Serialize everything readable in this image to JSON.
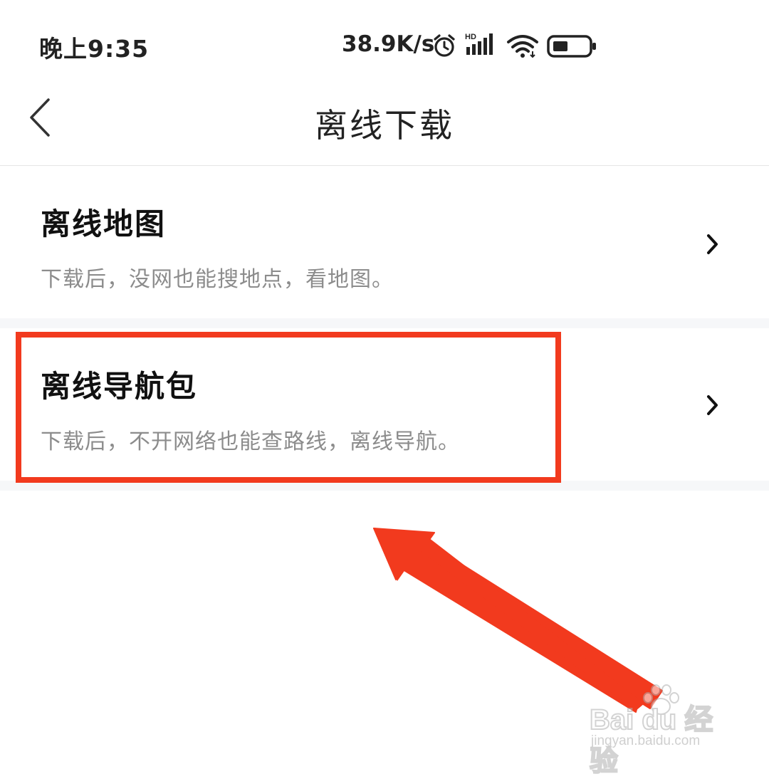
{
  "status_bar": {
    "time": "晚上9:35",
    "network_speed": "38.9K/s",
    "icons": [
      "alarm-icon",
      "hd-signal-icon",
      "wifi-icon",
      "battery-icon"
    ],
    "network_label": "HD"
  },
  "nav": {
    "title": "离线下载",
    "back_icon": "chevron-left-icon"
  },
  "items": [
    {
      "title": "离线地图",
      "description": "下载后，没网也能搜地点，看地图。"
    },
    {
      "title": "离线导航包",
      "description": "下载后，不开网络也能查路线，离线导航。"
    }
  ],
  "annotation": {
    "highlight_color": "#f23a1e",
    "highlighted_item": "离线导航包"
  },
  "watermark": {
    "brand": "Bai du 经验",
    "url": "jingyan.baidu.com"
  }
}
